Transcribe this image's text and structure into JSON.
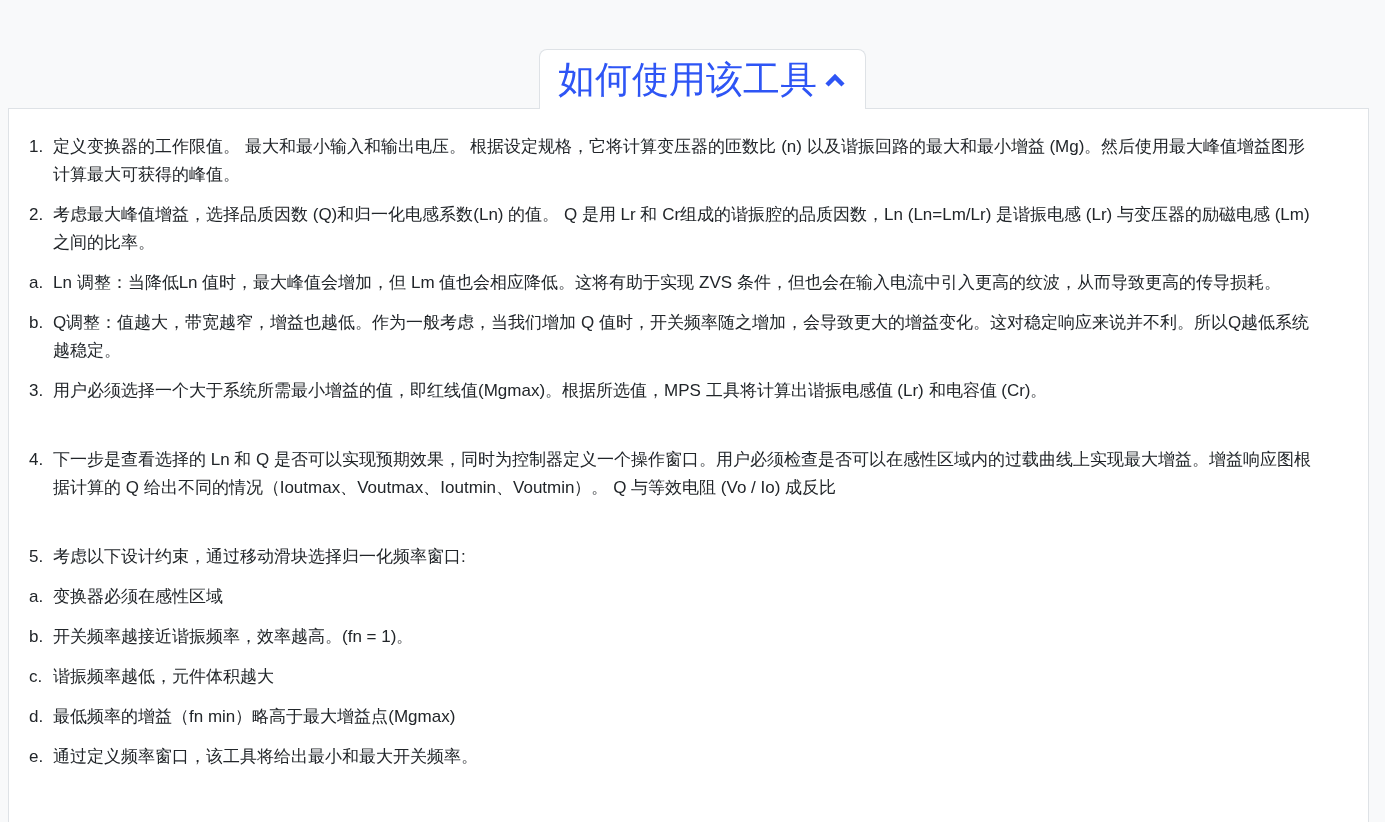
{
  "header_tab": {
    "title": "如何使用该工具",
    "expanded": true
  },
  "sections": [
    {
      "items": [
        {
          "marker": "1.",
          "text": "定义变换器的工作限值。 最大和最小输入和输出电压。 根据设定规格，它将计算变压器的匝数比 (n) 以及谐振回路的最大和最小增益 (Mg)。然后使用最大峰值增益图形计算最大可获得的峰值。"
        },
        {
          "marker": "2.",
          "text": "考虑最大峰值增益，选择品质因数 (Q)和归一化电感系数(Ln) 的值。 Q 是用 Lr 和 Cr组成的谐振腔的品质因数，Ln (Ln=Lm/Lr) 是谐振电感 (Lr) 与变压器的励磁电感 (Lm) 之间的比率。"
        },
        {
          "marker": "a.",
          "text": "Ln 调整：当降低Ln 值时，最大峰值会增加，但 Lm 值也会相应降低。这将有助于实现 ZVS 条件，但也会在输入电流中引入更高的纹波，从而导致更高的传导损耗。"
        },
        {
          "marker": "b.",
          "text": "Q调整：值越大，带宽越窄，增益也越低。作为一般考虑，当我们增加 Q 值时，开关频率随之增加，会导致更大的增益变化。这对稳定响应来说并不利。所以Q越低系统越稳定。"
        },
        {
          "marker": "3.",
          "text": "用户必须选择一个大于系统所需最小增益的值，即红线值(Mgmax)。根据所选值，MPS 工具将计算出谐振电感值 (Lr) 和电容值 (Cr)。"
        }
      ]
    },
    {
      "items": [
        {
          "marker": "4.",
          "text": "下一步是查看选择的 Ln 和 Q 是否可以实现预期效果，同时为控制器定义一个操作窗口。用户必须检查是否可以在感性区域内的过载曲线上实现最大增益。增益响应图根据计算的 Q 给出不同的情况（Ioutmax、Voutmax、Ioutmin、Voutmin）。 Q 与等效电阻 (Vo / Io) 成反比"
        }
      ]
    },
    {
      "items": [
        {
          "marker": "5.",
          "text": "考虑以下设计约束，通过移动滑块选择归一化频率窗口:"
        },
        {
          "marker": "a.",
          "text": "变换器必须在感性区域"
        },
        {
          "marker": "b.",
          "text": "开关频率越接近谐振频率，效率越高。(fn = 1)。"
        },
        {
          "marker": "c.",
          "text": "谐振频率越低，元件体积越大"
        },
        {
          "marker": "d.",
          "text": "最低频率的增益（fn min）略高于最大增益点(Mgmax)"
        },
        {
          "marker": "e.",
          "text": "通过定义频率窗口，该工具将给出最小和最大开关频率。"
        }
      ]
    }
  ]
}
